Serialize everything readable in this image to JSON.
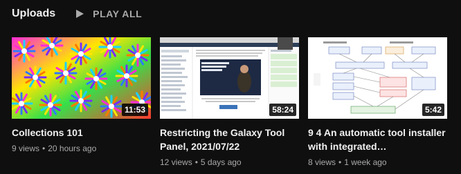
{
  "shelf": {
    "title": "Uploads",
    "play_all_label": "PLAY ALL"
  },
  "videos": [
    {
      "title": "Collections 101",
      "duration": "11:53",
      "views": "9 views",
      "age": "20 hours ago",
      "thumbnail_icon": "kaleidoscope-thumbnail"
    },
    {
      "title": "Restricting the Galaxy Tool Panel, 2021/07/22",
      "duration": "58:24",
      "views": "12 views",
      "age": "5 days ago",
      "thumbnail_icon": "screencast-thumbnail"
    },
    {
      "title": "9 4 An automatic tool installer with integrated…",
      "duration": "5:42",
      "views": "8 views",
      "age": "1 week ago",
      "thumbnail_icon": "flowchart-thumbnail"
    }
  ],
  "colors": {
    "background": "#0f0f0f",
    "text_primary": "#f1f1f1",
    "text_secondary": "#aaaaaa"
  }
}
